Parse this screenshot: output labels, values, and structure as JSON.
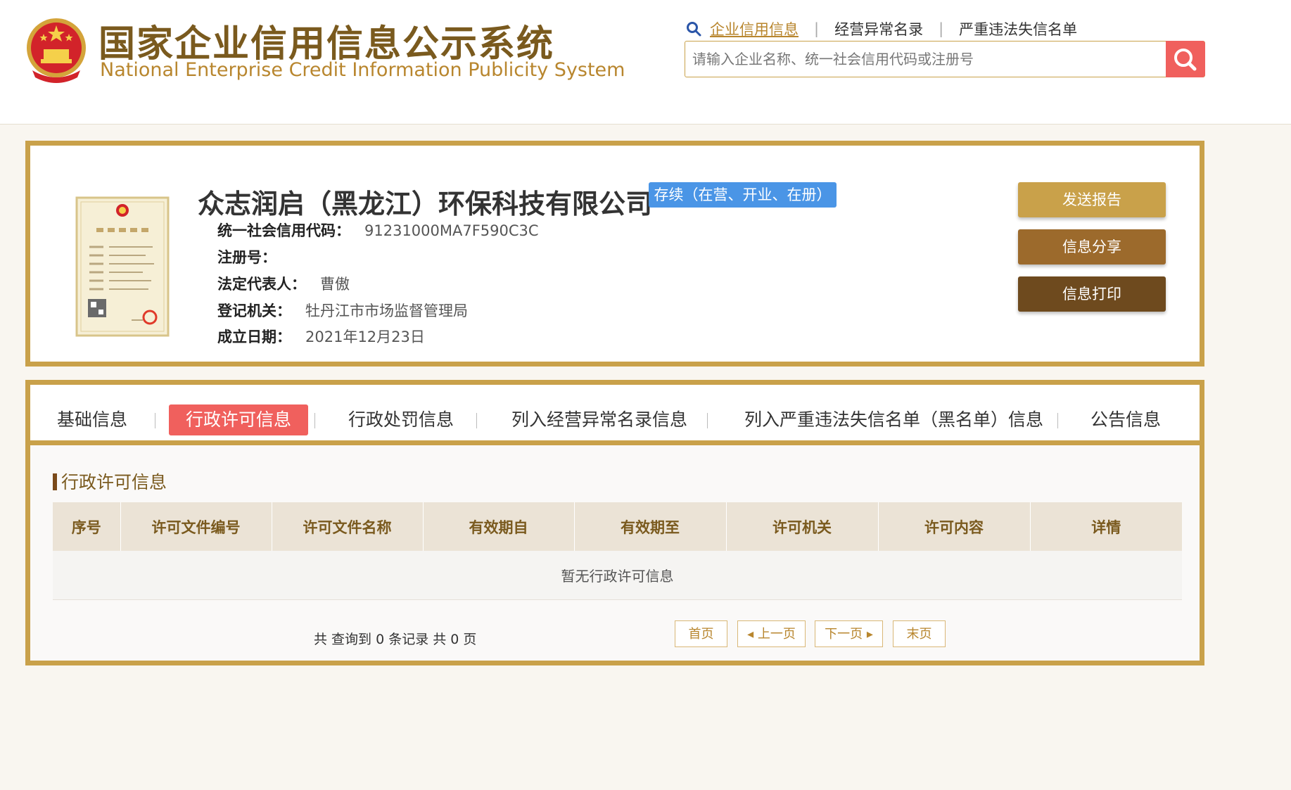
{
  "header": {
    "title_cn": "国家企业信用信息公示系统",
    "title_en": "National Enterprise Credit Information Publicity System",
    "search_tabs": [
      "企业信用信息",
      "经营异常名录",
      "严重违法失信名单"
    ],
    "search_placeholder": "请输入企业名称、统一社会信用代码或注册号"
  },
  "company": {
    "name": "众志润启（黑龙江）环保科技有限公司",
    "status": "存续（在营、开业、在册）",
    "fields": [
      {
        "label": "统一社会信用代码：",
        "value": "91231000MA7F590C3C"
      },
      {
        "label": "注册号：",
        "value": ""
      },
      {
        "label": "法定代表人：",
        "value": "曹傲"
      },
      {
        "label": "登记机关：",
        "value": "牡丹江市市场监督管理局"
      },
      {
        "label": "成立日期：",
        "value": "2021年12月23日"
      }
    ],
    "license_image_text": "营业执照",
    "actions": [
      "发送报告",
      "信息分享",
      "信息打印"
    ]
  },
  "tabs": [
    "基础信息",
    "行政许可信息",
    "行政处罚信息",
    "列入经营异常名录信息",
    "列入严重违法失信名单（黑名单）信息",
    "公告信息"
  ],
  "active_tab": "行政许可信息",
  "section": {
    "title": "行政许可信息",
    "columns": [
      "序号",
      "许可文件编号",
      "许可文件名称",
      "有效期自",
      "有效期至",
      "许可机关",
      "许可内容",
      "详情"
    ],
    "empty_message": "暂无行政许可信息"
  },
  "pager": {
    "summary": "共 查询到 0 条记录 共 0 页",
    "first": "首页",
    "prev": "上一页",
    "next": "下一页",
    "last": "末页"
  },
  "colors": {
    "gold": "#c9a14a",
    "brown_text": "#7a5a1e",
    "accent_red": "#f0605d",
    "status_blue": "#4a95e6",
    "btn_send": "#c9a14a",
    "btn_share": "#9c6a2c",
    "btn_print": "#6e4a1e"
  }
}
